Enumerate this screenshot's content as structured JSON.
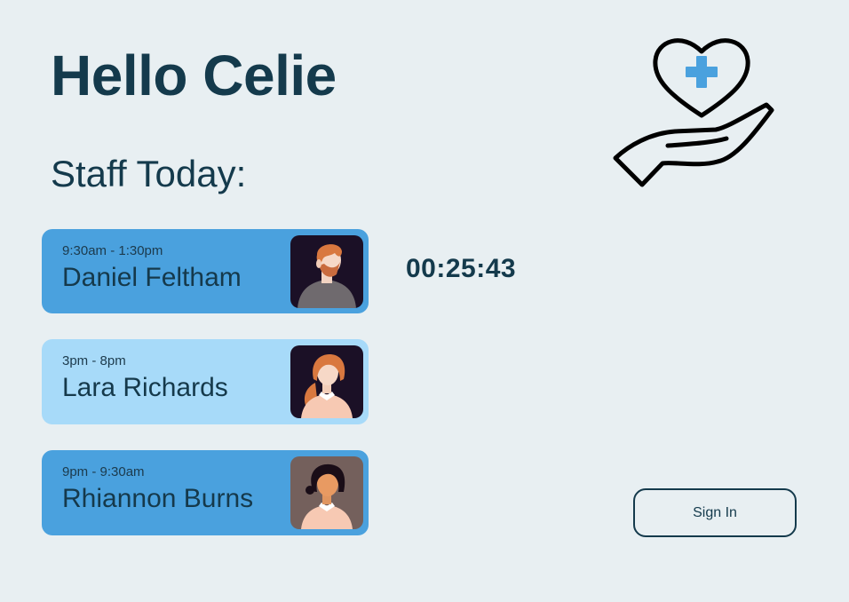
{
  "greeting": "Hello Celie",
  "staff_heading": "Staff Today:",
  "timer": "00:25:43",
  "sign_in_label": "Sign In",
  "logo": {
    "icon": "heart-hand-care-icon",
    "accent_color": "#4aa1de"
  },
  "staff": [
    {
      "time": "9:30am - 1:30pm",
      "name": "Daniel Feltham",
      "card_color": "#4aa1de",
      "avatar": "man-beard-avatar"
    },
    {
      "time": "3pm - 8pm",
      "name": "Lara Richards",
      "card_color": "#a7daf9",
      "avatar": "woman-ginger-hair-avatar"
    },
    {
      "time": "9pm - 9:30am",
      "name": "Rhiannon Burns",
      "card_color": "#4aa1de",
      "avatar": "woman-dark-hair-avatar"
    }
  ],
  "colors": {
    "background": "#e8eff2",
    "text_dark": "#143a4c",
    "card_active": "#4aa1de",
    "card_light": "#a7daf9"
  }
}
